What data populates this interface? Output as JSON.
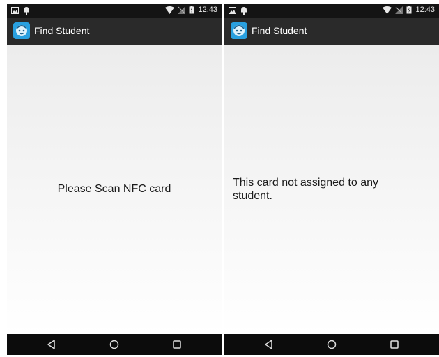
{
  "screens": [
    {
      "status": {
        "time": "12:43"
      },
      "app": {
        "title": "Find Student",
        "icon": "student-face-icon"
      },
      "message": "Please Scan NFC card"
    },
    {
      "status": {
        "time": "12:43"
      },
      "app": {
        "title": "Find Student",
        "icon": "student-face-icon"
      },
      "message": "This card not assigned to any student."
    }
  ],
  "colors": {
    "status_bar": "#141414",
    "action_bar": "#2a2a2a",
    "content_bg": "#f4f4f4",
    "nav_bar": "#0c0c0c",
    "app_icon_blue": "#29a0e0"
  },
  "navigation": {
    "buttons": [
      "back-icon",
      "home-icon",
      "recents-icon"
    ]
  }
}
